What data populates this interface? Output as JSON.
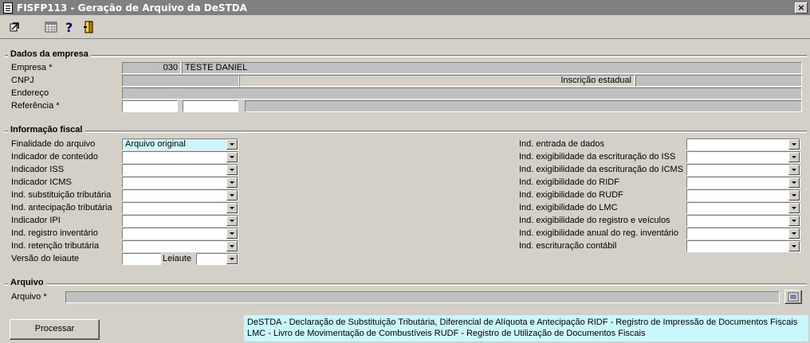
{
  "window": {
    "title": "FISFP113 - Geração de Arquivo da DeSTDA",
    "close": "×"
  },
  "toolbar": [
    "exit-icon",
    "calendar-icon",
    "help-icon",
    "door-icon"
  ],
  "company": {
    "title": "Dados da empresa",
    "empresa_label": "Empresa *",
    "empresa_code": "030",
    "empresa_name": "TESTE DANIEL",
    "cnpj_label": "CNPJ",
    "cnpj_value": "",
    "ie_label": "Inscrição estadual",
    "ie_value": "",
    "endereco_label": "Endereço",
    "endereco_value": "",
    "referencia_label": "Referência *",
    "ref_from": "",
    "ref_to": "",
    "ref_desc": ""
  },
  "fiscal": {
    "title": "Informação fiscal",
    "left": [
      {
        "label": "Finalidade do arquivo",
        "value": "Arquivo original"
      },
      {
        "label": "Indicador de conteúdo",
        "value": ""
      },
      {
        "label": "Indicador ISS",
        "value": ""
      },
      {
        "label": "Indicador ICMS",
        "value": ""
      },
      {
        "label": "Ind. substituição tributária",
        "value": ""
      },
      {
        "label": "Ind. antecipação tributária",
        "value": ""
      },
      {
        "label": "Indicador IPI",
        "value": ""
      },
      {
        "label": "Ind. registro inventário",
        "value": ""
      },
      {
        "label": "Ind. retenção tributária",
        "value": ""
      }
    ],
    "versao_label": "Versão do leiaute",
    "versao_value": "",
    "leiaute_label": "Leiaute",
    "leiaute_value": "",
    "right": [
      {
        "label": "Ind. entrada de dados",
        "value": ""
      },
      {
        "label": "Ind. exigibilidade da escrituração do ISS",
        "value": ""
      },
      {
        "label": "Ind. exigibilidade da escrituração do ICMS",
        "value": ""
      },
      {
        "label": "Ind. exigibilidade do RIDF",
        "value": ""
      },
      {
        "label": "Ind. exigibilidade do RUDF",
        "value": ""
      },
      {
        "label": "Ind. exigibilidade do LMC",
        "value": ""
      },
      {
        "label": "Ind. exigibilidade do registro e veículos",
        "value": ""
      },
      {
        "label": "Ind. exigibilidade anual do reg. inventário",
        "value": ""
      },
      {
        "label": "Ind. escrituração contábil",
        "value": ""
      }
    ]
  },
  "arquivo": {
    "title": "Arquivo",
    "label": "Arquivo *",
    "value": ""
  },
  "actions": {
    "process": "Processar"
  },
  "legend": {
    "line1": "DeSTDA - Declaração de Substituição Tributária, Diferencial de Alíquota e Antecipação  RIDF - Registro de Impressão de Documentos Fiscais",
    "line2": "LMC - Livro de Movimentação de Combustíveis  RUDF - Registro de Utilização de Documentos Fiscais"
  },
  "colors": {
    "window_bg": "#d4d0c8",
    "title_bg": "#808080",
    "highlight": "#c9f7fb",
    "readonly": "#c0c0c0"
  }
}
